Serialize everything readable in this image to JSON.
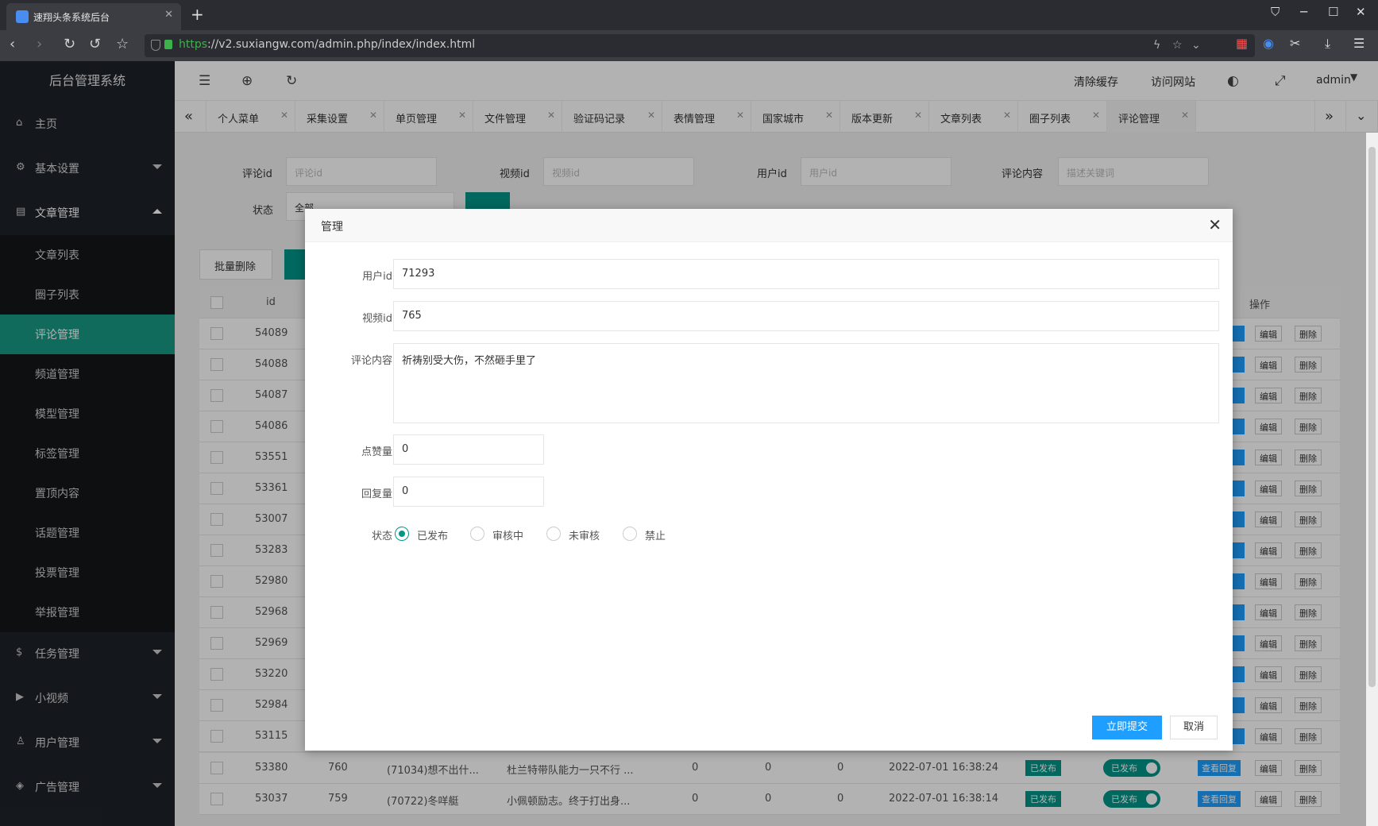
{
  "browser": {
    "tab_title": "速翔头条系统后台",
    "url_scheme": "https",
    "url_rest": "://v2.suxiangw.com/admin.php/index/index.html"
  },
  "sidebar": {
    "title": "后台管理系统",
    "top_items": [
      {
        "label": "主页",
        "icon": "home-icon"
      },
      {
        "label": "基本设置",
        "icon": "gear-icon"
      },
      {
        "label": "文章管理",
        "icon": "document-icon"
      }
    ],
    "sub_items": [
      "文章列表",
      "圈子列表",
      "评论管理",
      "频道管理",
      "模型管理",
      "标签管理",
      "置顶内容",
      "话题管理",
      "投票管理",
      "举报管理"
    ],
    "active_sub": "评论管理",
    "bottom_items": [
      {
        "label": "任务管理",
        "icon": "coin-icon"
      },
      {
        "label": "小视频",
        "icon": "play-icon"
      },
      {
        "label": "用户管理",
        "icon": "user-icon"
      },
      {
        "label": "广告管理",
        "icon": "tag-icon"
      }
    ]
  },
  "header": {
    "clear_cache": "清除缓存",
    "visit_site": "访问网站",
    "user": "admin"
  },
  "tabs": [
    "个人菜单",
    "采集设置",
    "单页管理",
    "文件管理",
    "验证码记录",
    "表情管理",
    "国家城市",
    "版本更新",
    "文章列表",
    "圈子列表",
    "评论管理"
  ],
  "active_tab": "评论管理",
  "filters": {
    "comment_id_label": "评论id",
    "comment_id_placeholder": "评论id",
    "video_id_label": "视频id",
    "video_id_placeholder": "视频id",
    "user_id_label": "用户id",
    "user_id_placeholder": "用户id",
    "content_label": "评论内容",
    "content_placeholder": "描述关键词",
    "status_label": "状态",
    "status_value": "全部"
  },
  "toolbar": {
    "batch_delete": "批量删除"
  },
  "table": {
    "id_header": "id",
    "action_header": "操作",
    "ids": [
      "54089",
      "54088",
      "54087",
      "54086",
      "53551",
      "53361",
      "53007",
      "53283",
      "52980",
      "52968",
      "52969",
      "53220",
      "52984",
      "53115"
    ],
    "full_rows": [
      {
        "id": "53380",
        "video": "760",
        "user": "(71034)想不出什...",
        "content": "杜兰特带队能力一只不行 ...",
        "likes": "0",
        "replies": "0",
        "c3": "0",
        "time": "2022-07-01 16:38:24",
        "status": "已发布",
        "switch": "已发布"
      },
      {
        "id": "53037",
        "video": "759",
        "user": "(70722)冬咩艇",
        "content": "小佩顿励志。终于打出身...",
        "likes": "0",
        "replies": "0",
        "c3": "0",
        "time": "2022-07-01 16:38:14",
        "status": "已发布",
        "switch": "已发布"
      }
    ],
    "btn_view": "查看回复",
    "btn_edit": "编辑",
    "btn_delete": "删除"
  },
  "dialog": {
    "title": "管理",
    "user_id_label": "用户id",
    "user_id": "71293",
    "video_id_label": "视频id",
    "video_id": "765",
    "content_label": "评论内容",
    "content": "祈祷别受大伤，不然砸手里了",
    "likes_label": "点赞量",
    "likes": "0",
    "replies_label": "回复量",
    "replies": "0",
    "status_label": "状态",
    "status_options": [
      "已发布",
      "审核中",
      "未审核",
      "禁止"
    ],
    "status_selected": "已发布",
    "submit": "立即提交",
    "cancel": "取消"
  },
  "colors": {
    "accent": "#009688",
    "primary": "#1e9fff",
    "sidebar_bg": "#1e2229"
  }
}
